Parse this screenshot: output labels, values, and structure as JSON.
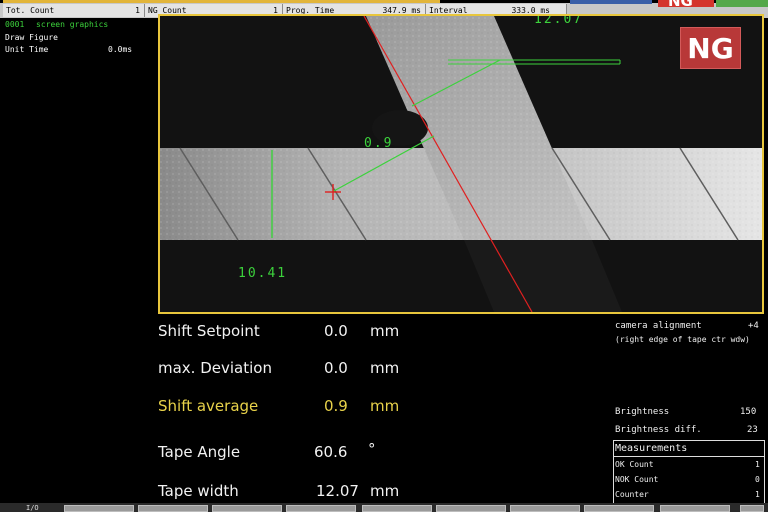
{
  "top_bar": {
    "tot_count_label": "Tot. Count",
    "tot_count_value": "1",
    "ng_count_label": "NG Count",
    "ng_count_value": "1",
    "prog_time_label": "Prog. Time",
    "prog_time_value": "347.9 ms",
    "interval_label": "Interval",
    "interval_value": "333.0 ms",
    "status_text": "NG"
  },
  "left_panel": {
    "program_number": "0001",
    "program_name": "screen graphics",
    "draw_figure": "Draw Figure",
    "unit_time_label": "Unit Time",
    "unit_time_value": "0.0ms"
  },
  "camera": {
    "ng_badge": "NG",
    "overlay_top_value": "12.07",
    "overlay_shift_value": "0.9",
    "overlay_width_value": "10.41"
  },
  "measurements_main": [
    {
      "label": "Shift  Setpoint",
      "value": "0.0",
      "unit": "mm",
      "highlight": false
    },
    {
      "label": "max.  Deviation",
      "value": "0.0",
      "unit": "mm",
      "highlight": false
    },
    {
      "label": "Shift  average",
      "value": "0.9",
      "unit": "mm",
      "highlight": true
    },
    {
      "label": "Tape  Angle",
      "value": "60.6",
      "unit": "°",
      "highlight": false
    },
    {
      "label": "Tape  width",
      "value": "12.07",
      "unit": "mm",
      "highlight": false
    }
  ],
  "right_info": {
    "camera_alignment_label": "camera alignment",
    "camera_alignment_value": "+4",
    "camera_alignment_note": "(right edge of tape ctr wdw)",
    "brightness_label": "Brightness",
    "brightness_value": "150",
    "brightness_diff_label": "Brightness diff.",
    "brightness_diff_value": "23"
  },
  "measurements_box": {
    "title": "Measurements",
    "rows": [
      {
        "label": "OK Count",
        "value": "1"
      },
      {
        "label": "NOK Count",
        "value": "0"
      },
      {
        "label": "Counter",
        "value": "1"
      }
    ]
  },
  "bottom_bar": {
    "first_label": "I/O"
  },
  "colors": {
    "frame_yellow": "#e8c63c",
    "overlay_green": "#3cd23c",
    "alignment_red": "#e02020",
    "ng_red": "#b83838"
  }
}
